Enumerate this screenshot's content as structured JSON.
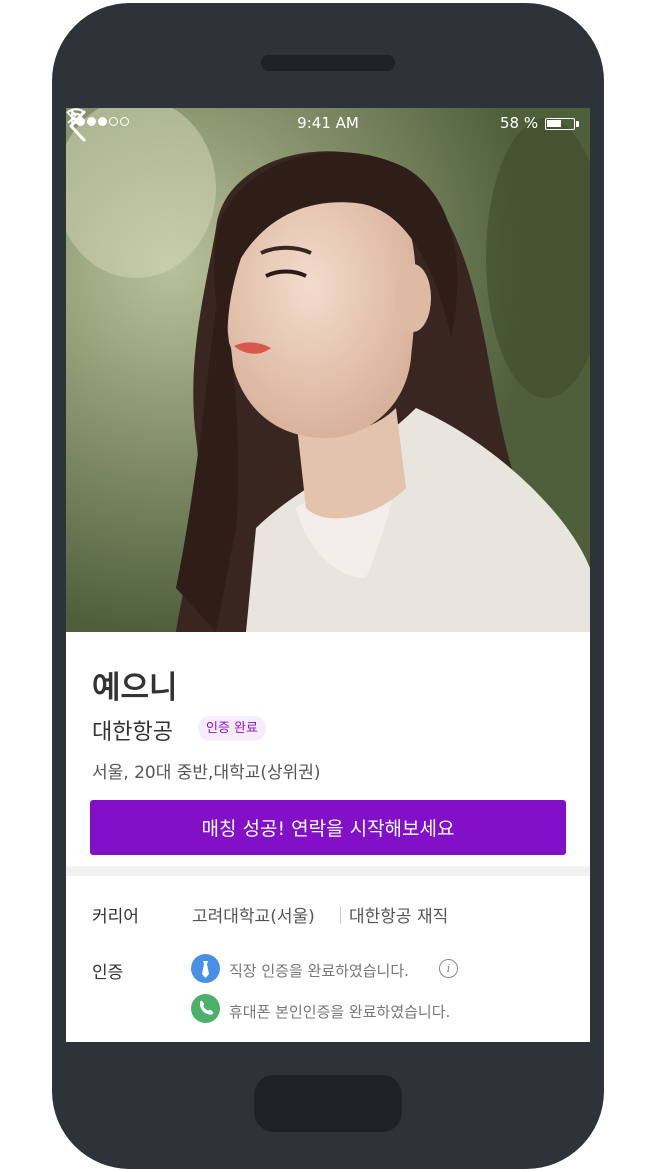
{
  "status_bar": {
    "time": "9:41 AM",
    "battery_text": "58 %",
    "battery_level": 0.58,
    "signal_bars_filled": 3,
    "signal_bars_total": 5
  },
  "profile": {
    "name": "예으니",
    "company": "대한항공",
    "verification_badge": "인증 완료",
    "details": "서울, 20대 중반,대학교(상위권)",
    "cta_label": "매칭 성공! 연락을 시작해보세요"
  },
  "career": {
    "label": "커리어",
    "school": "고려대학교(서울)",
    "job": "대한항공 재직"
  },
  "verification": {
    "label": "인증",
    "items": [
      {
        "text": "직장 인증을 완료하였습니다.",
        "icon": "tie-icon",
        "color": "#4a90e2"
      },
      {
        "text": "휴대폰 본인인증을 완료하였습니다.",
        "icon": "phone-icon",
        "color": "#4caf6a"
      }
    ],
    "info_glyph": "i"
  },
  "colors": {
    "accent": "#8110c6",
    "badge_bg": "#f6ecfb",
    "device": "#2d3338"
  }
}
